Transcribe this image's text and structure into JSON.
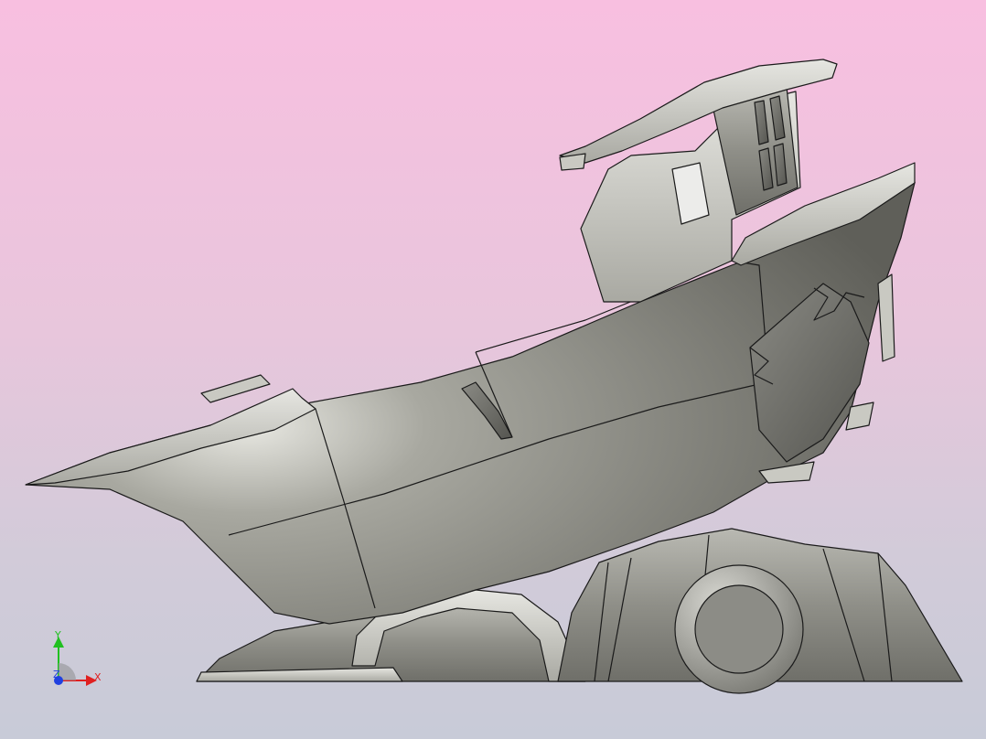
{
  "viewport": {
    "background_top": "#f8bfe0",
    "background_bottom": "#c8cbd8",
    "model_name": "",
    "model_color": "#9e9e96"
  },
  "axis_triad": {
    "x_label": "X",
    "y_label": "Y",
    "z_label": "Z",
    "x_color": "#e02020",
    "y_color": "#20c020",
    "z_color": "#2040e0"
  }
}
